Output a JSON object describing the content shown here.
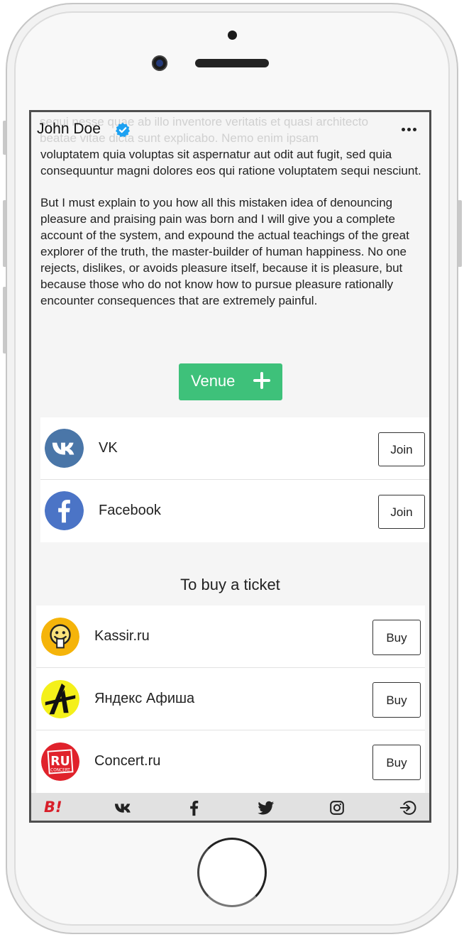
{
  "profile": {
    "name": "John Doe",
    "ghost_lines": [
      "sequi nesse quae ab illo inventore veritatis et quasi architecto",
      "beatae vitae dicta sunt explicabo. Nemo enim ipsam"
    ]
  },
  "body": {
    "paragraph_1": "voluptatem quia voluptas sit aspernatur aut odit aut fugit, sed quia consequuntur magni dolores eos qui ratione voluptatem sequi nesciunt.",
    "paragraph_2": "But I must explain to you how all this mistaken idea of denouncing pleasure and praising pain was born and I will give you a complete account of the system, and expound the actual teachings of the great explorer of the truth, the master-builder of human happiness. No one rejects, dislikes, or avoids pleasure itself, because it is pleasure, but because those who do not know how to pursue pleasure rationally encounter consequences that are extremely painful."
  },
  "venue_button": {
    "label": "Venue"
  },
  "social": [
    {
      "name": "VK",
      "action": "Join",
      "icon": "vk-icon",
      "color": "#4a76a8"
    },
    {
      "name": "Facebook",
      "action": "Join",
      "icon": "facebook-icon",
      "color": "#4b74c6"
    }
  ],
  "tickets": {
    "title": "To buy a ticket",
    "items": [
      {
        "name": "Kassir.ru",
        "action": "Buy",
        "icon": "kassir-logo",
        "color": "#f5b40a"
      },
      {
        "name": "Яндекс Афиша",
        "action": "Buy",
        "icon": "yandex-afisha-logo",
        "color": "#f4f01a"
      },
      {
        "name": "Concert.ru",
        "action": "Buy",
        "icon": "concert-ru-logo",
        "color": "#e0222b"
      },
      {
        "logo_text": "RU",
        "logo_subtext": "CONCERT"
      }
    ]
  },
  "bottom_nav": [
    {
      "name": "brand-icon",
      "text": "B!"
    },
    {
      "name": "vk-icon"
    },
    {
      "name": "facebook-icon"
    },
    {
      "name": "twitter-icon"
    },
    {
      "name": "instagram-icon"
    },
    {
      "name": "login-icon"
    }
  ],
  "colors": {
    "accent_green": "#3ec17a",
    "verified_blue": "#1da1f2",
    "brand_red": "#d81f2a"
  }
}
